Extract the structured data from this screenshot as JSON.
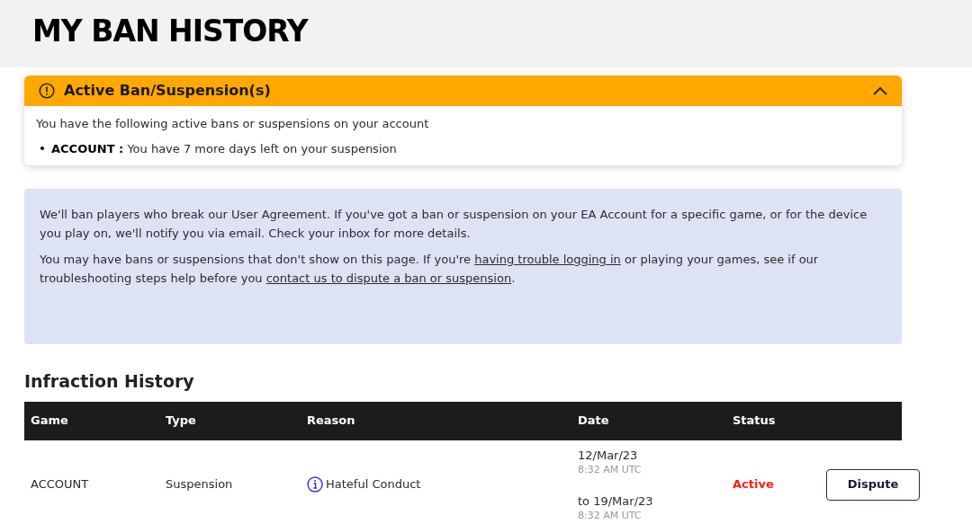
{
  "page_title": "MY BAN HISTORY",
  "alert": {
    "title": "Active Ban/Suspension(s)",
    "expanded": true,
    "intro": "You have the following active bans or suspensions on your account",
    "items": [
      {
        "label": "ACCOUNT :",
        "text": "You have 7 more days left on your suspension"
      }
    ]
  },
  "notice": {
    "paragraphs": [
      [
        {
          "kind": "text",
          "text": "We'll ban players who break our User Agreement. If you've got a ban or suspension on your EA Account for a specific game, or for the device you play on, we'll notify you via email. Check your inbox for more details."
        }
      ],
      [
        {
          "kind": "text",
          "text": "You may have bans or suspensions that don't show on this page. If you're "
        },
        {
          "kind": "link",
          "text": "having trouble logging in"
        },
        {
          "kind": "text",
          "text": " or playing your games, see if our troubleshooting steps help before you "
        },
        {
          "kind": "link",
          "text": "contact us to dispute a ban or suspension"
        },
        {
          "kind": "text",
          "text": "."
        }
      ]
    ]
  },
  "infractions": {
    "title": "Infraction History",
    "columns": [
      "Game",
      "Type",
      "Reason",
      "Date",
      "Status"
    ],
    "rows": [
      {
        "game": "ACCOUNT",
        "type": "Suspension",
        "reason": "Hateful Conduct",
        "start_date": "12/Mar/23",
        "start_time": "8:32 AM UTC",
        "end_date": "to 19/Mar/23",
        "end_time": "8:32 AM UTC",
        "status": "Active",
        "active": true,
        "action": "Dispute"
      }
    ]
  }
}
